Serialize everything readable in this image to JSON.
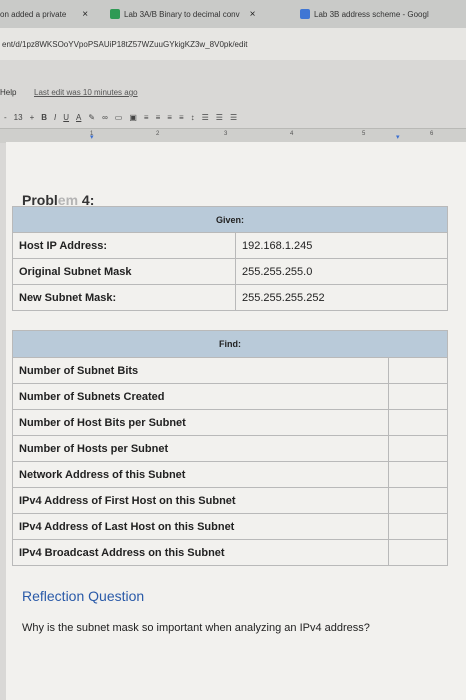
{
  "browser": {
    "tabs": [
      {
        "label": "on added a private",
        "close": "×"
      },
      {
        "label": "Lab 3A/B Binary to decimal conv",
        "close": "×"
      },
      {
        "label": "Lab 3B address scheme - Googl"
      }
    ],
    "url": "ent/d/1pz8WKSOoYVpoPSAUiP18tZ57WZuuGYkigKZ3w_8V0pk/edit"
  },
  "menubar": {
    "help": "Help",
    "last_edit": "Last edit was 10 minutes ago"
  },
  "toolbar": {
    "font_size": "13",
    "plus": "+",
    "minus": "-",
    "bold": "B",
    "italic": "I",
    "underline": "U",
    "color": "A"
  },
  "ruler": {
    "marks": [
      "1",
      "2",
      "3",
      "4",
      "5",
      "6"
    ]
  },
  "document": {
    "problem_title_a": "Probl",
    "problem_title_b": "em",
    "problem_title_c": " 4:",
    "given": {
      "header": "Given:",
      "rows": [
        {
          "label": "Host IP Address:",
          "value": "192.168.1.245"
        },
        {
          "label": "Original Subnet Mask",
          "value": "255.255.255.0"
        },
        {
          "label": "New Subnet Mask:",
          "value": "255.255.255.252"
        }
      ]
    },
    "find": {
      "header": "Find:",
      "rows": [
        "Number of Subnet Bits",
        "Number of Subnets Created",
        "Number of Host Bits per Subnet",
        "Number of Hosts per Subnet",
        "Network Address of this Subnet",
        "IPv4 Address of First Host on this Subnet",
        "IPv4 Address of Last Host on this Subnet",
        "IPv4 Broadcast Address on this Subnet"
      ]
    },
    "reflection_title": "Reflection Question",
    "reflection_question": "Why is the subnet mask so important when analyzing an IPv4 address?"
  }
}
